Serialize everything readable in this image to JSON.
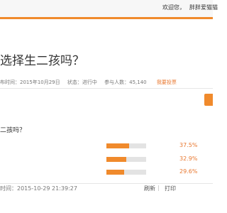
{
  "topbar": {
    "welcome": "欢迎您，",
    "username": "胖胖爱猫猫"
  },
  "survey": {
    "title": "选择生二孩吗？",
    "meta": {
      "publish_time": "布时间：2015年10月29日",
      "status": "状态：进行中",
      "participants": "参与人数：45,140",
      "report": "我要投票"
    },
    "question": "二孩吗？",
    "options": [
      {
        "percent": 37.5,
        "percent_text": "37.5%"
      },
      {
        "percent": 32.9,
        "percent_text": "32.9%"
      },
      {
        "percent": 29.6,
        "percent_text": "29.6%"
      }
    ]
  },
  "footer": {
    "time": "时间：2015-10-29 21:39:27",
    "refresh": "刷新",
    "separator": "|",
    "print": "打印"
  },
  "colors": {
    "accent": "#f08a2c",
    "track": "#e3e3e3"
  }
}
